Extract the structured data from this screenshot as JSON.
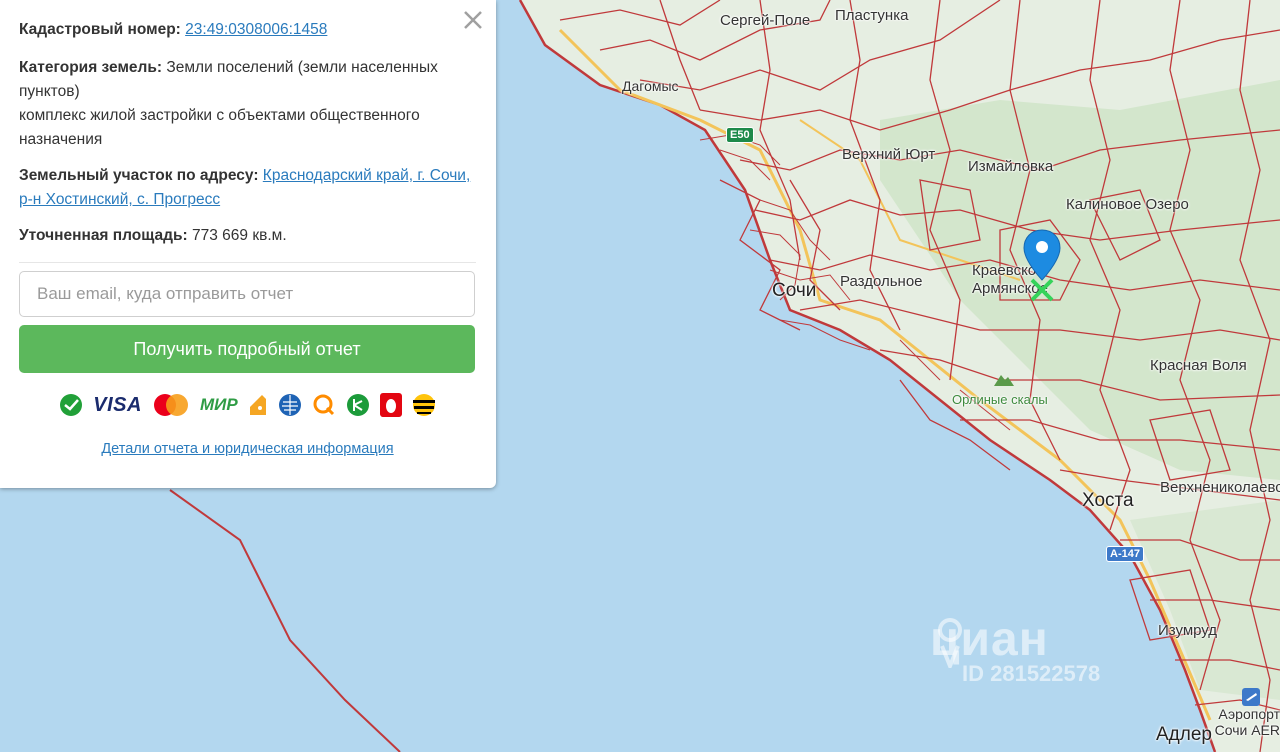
{
  "card": {
    "cadastral_label": "Кадастровый номер:",
    "cadastral_value": "23:49:0308006:1458",
    "category_label": "Категория земель:",
    "category_value": "Земли поселений (земли населенных пунктов)",
    "category_use": "комплекс жилой застройки с объектами общественного назначения",
    "address_label": "Земельный участок по адресу:",
    "address_value": "Краснодарский край, г. Сочи, р-н Хостинский, с. Прогресс",
    "area_label": "Уточненная площадь:",
    "area_value": "773 669 кв.м.",
    "email_placeholder": "Ваш email, куда отправить отчет",
    "email_value": "",
    "submit_label": "Получить подробный отчет",
    "payment_icons": [
      "sberbank-icon",
      "visa-icon",
      "mastercard-icon",
      "mir-icon",
      "yandex-money-icon",
      "webmoney-icon",
      "qiwi-icon",
      "sber-spasibo-icon",
      "mts-icon",
      "beeline-icon"
    ],
    "visa_text": "VISA",
    "mir_text": "МИР",
    "details_link": "Детали отчета и юридическая информация"
  },
  "map": {
    "places": {
      "sergey_pole": "Сергей-Поле",
      "plastunka": "Пластунка",
      "dagomys": "Дагомыс",
      "verkhniy_yurt": "Верхний Юрт",
      "izmaylovka": "Измайловка",
      "kalinovoe_ozero": "Калиновое Озеро",
      "kraevsko_armyanskoe": "Краевско-Армянское",
      "razdolnoe": "Раздольное",
      "sochi": "Сочи",
      "krasnaya_volya": "Красная Воля",
      "orlinye_skaly": "Орлиные скалы",
      "khosta": "Хоста",
      "verkhnenikolaevskoe": "Верхнениколаевское",
      "izumrud": "Изумруд",
      "airport": "Аэропорт Сочи AER",
      "adler": "Адлер"
    },
    "road_e": "E50",
    "road_a": "A-147",
    "watermark_logo": "циан",
    "watermark_id": "ID 281522578",
    "colors": {
      "sea": "#b3d7ef",
      "land": "#e6eee2",
      "boundary": "#c0393b",
      "road": "#f3c45a",
      "marker": "#1d8be1",
      "button": "#5cb85c",
      "link": "#2a7bbd"
    }
  }
}
